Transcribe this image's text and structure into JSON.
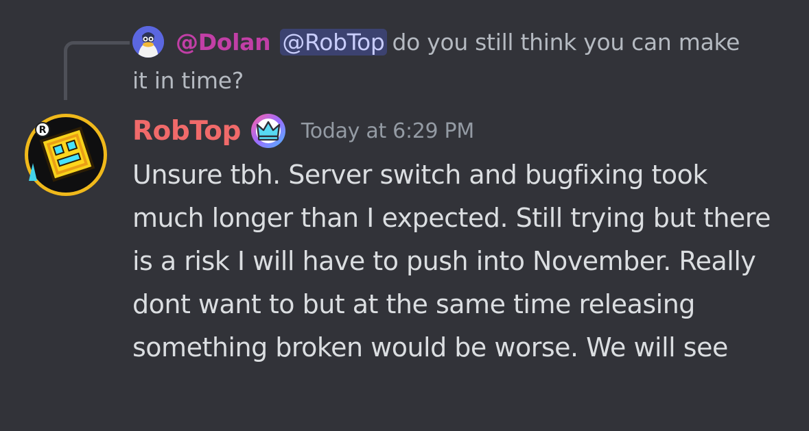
{
  "reply": {
    "author": "@Dolan",
    "mention": "@RobTop",
    "text": "do you still think you can make it in time?",
    "avatar_icon": "duck-avatar"
  },
  "message": {
    "author": "RobTop",
    "badge_icon": "crown-badge-icon",
    "timestamp": "Today at 6:29 PM",
    "avatar_icon": "geometry-dash-cube-avatar",
    "body": "Unsure tbh. Server switch and bugfixing took much longer than I expected. Still trying but there is a risk I will have to push into November. Really dont want to but at the same time releasing something broken would be worse. We will see"
  },
  "colors": {
    "background": "#323339",
    "reply_author": "#c13fa6",
    "author": "#f06a6a",
    "mention_bg": "#3c4270",
    "mention_text": "#c9cdfb",
    "timestamp": "#949ba4",
    "body_text": "#dbdee1"
  }
}
